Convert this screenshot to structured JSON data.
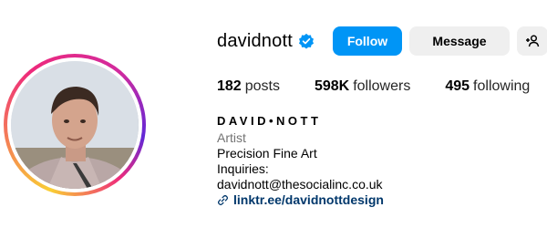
{
  "profile": {
    "username": "davidnott",
    "verified_icon": "verified-badge-icon",
    "display_name": "DAVID•NOTT",
    "category": "Artist",
    "bio_lines": [
      "Precision Fine Art",
      "Inquiries:",
      "davidnott@thesocialinc.co.uk"
    ],
    "link": "linktr.ee/davidnottdesign"
  },
  "actions": {
    "follow_label": "Follow",
    "message_label": "Message",
    "add_user_icon": "person-add-icon",
    "more_icon": "more-options-icon"
  },
  "stats": {
    "posts": {
      "count": "182",
      "label": "posts"
    },
    "followers": {
      "count": "598K",
      "label": "followers"
    },
    "following": {
      "count": "495",
      "label": "following"
    }
  },
  "colors": {
    "follow_button": "#0095f6",
    "secondary_button": "#efefef",
    "link": "#00376b",
    "verified": "#0095f6"
  }
}
